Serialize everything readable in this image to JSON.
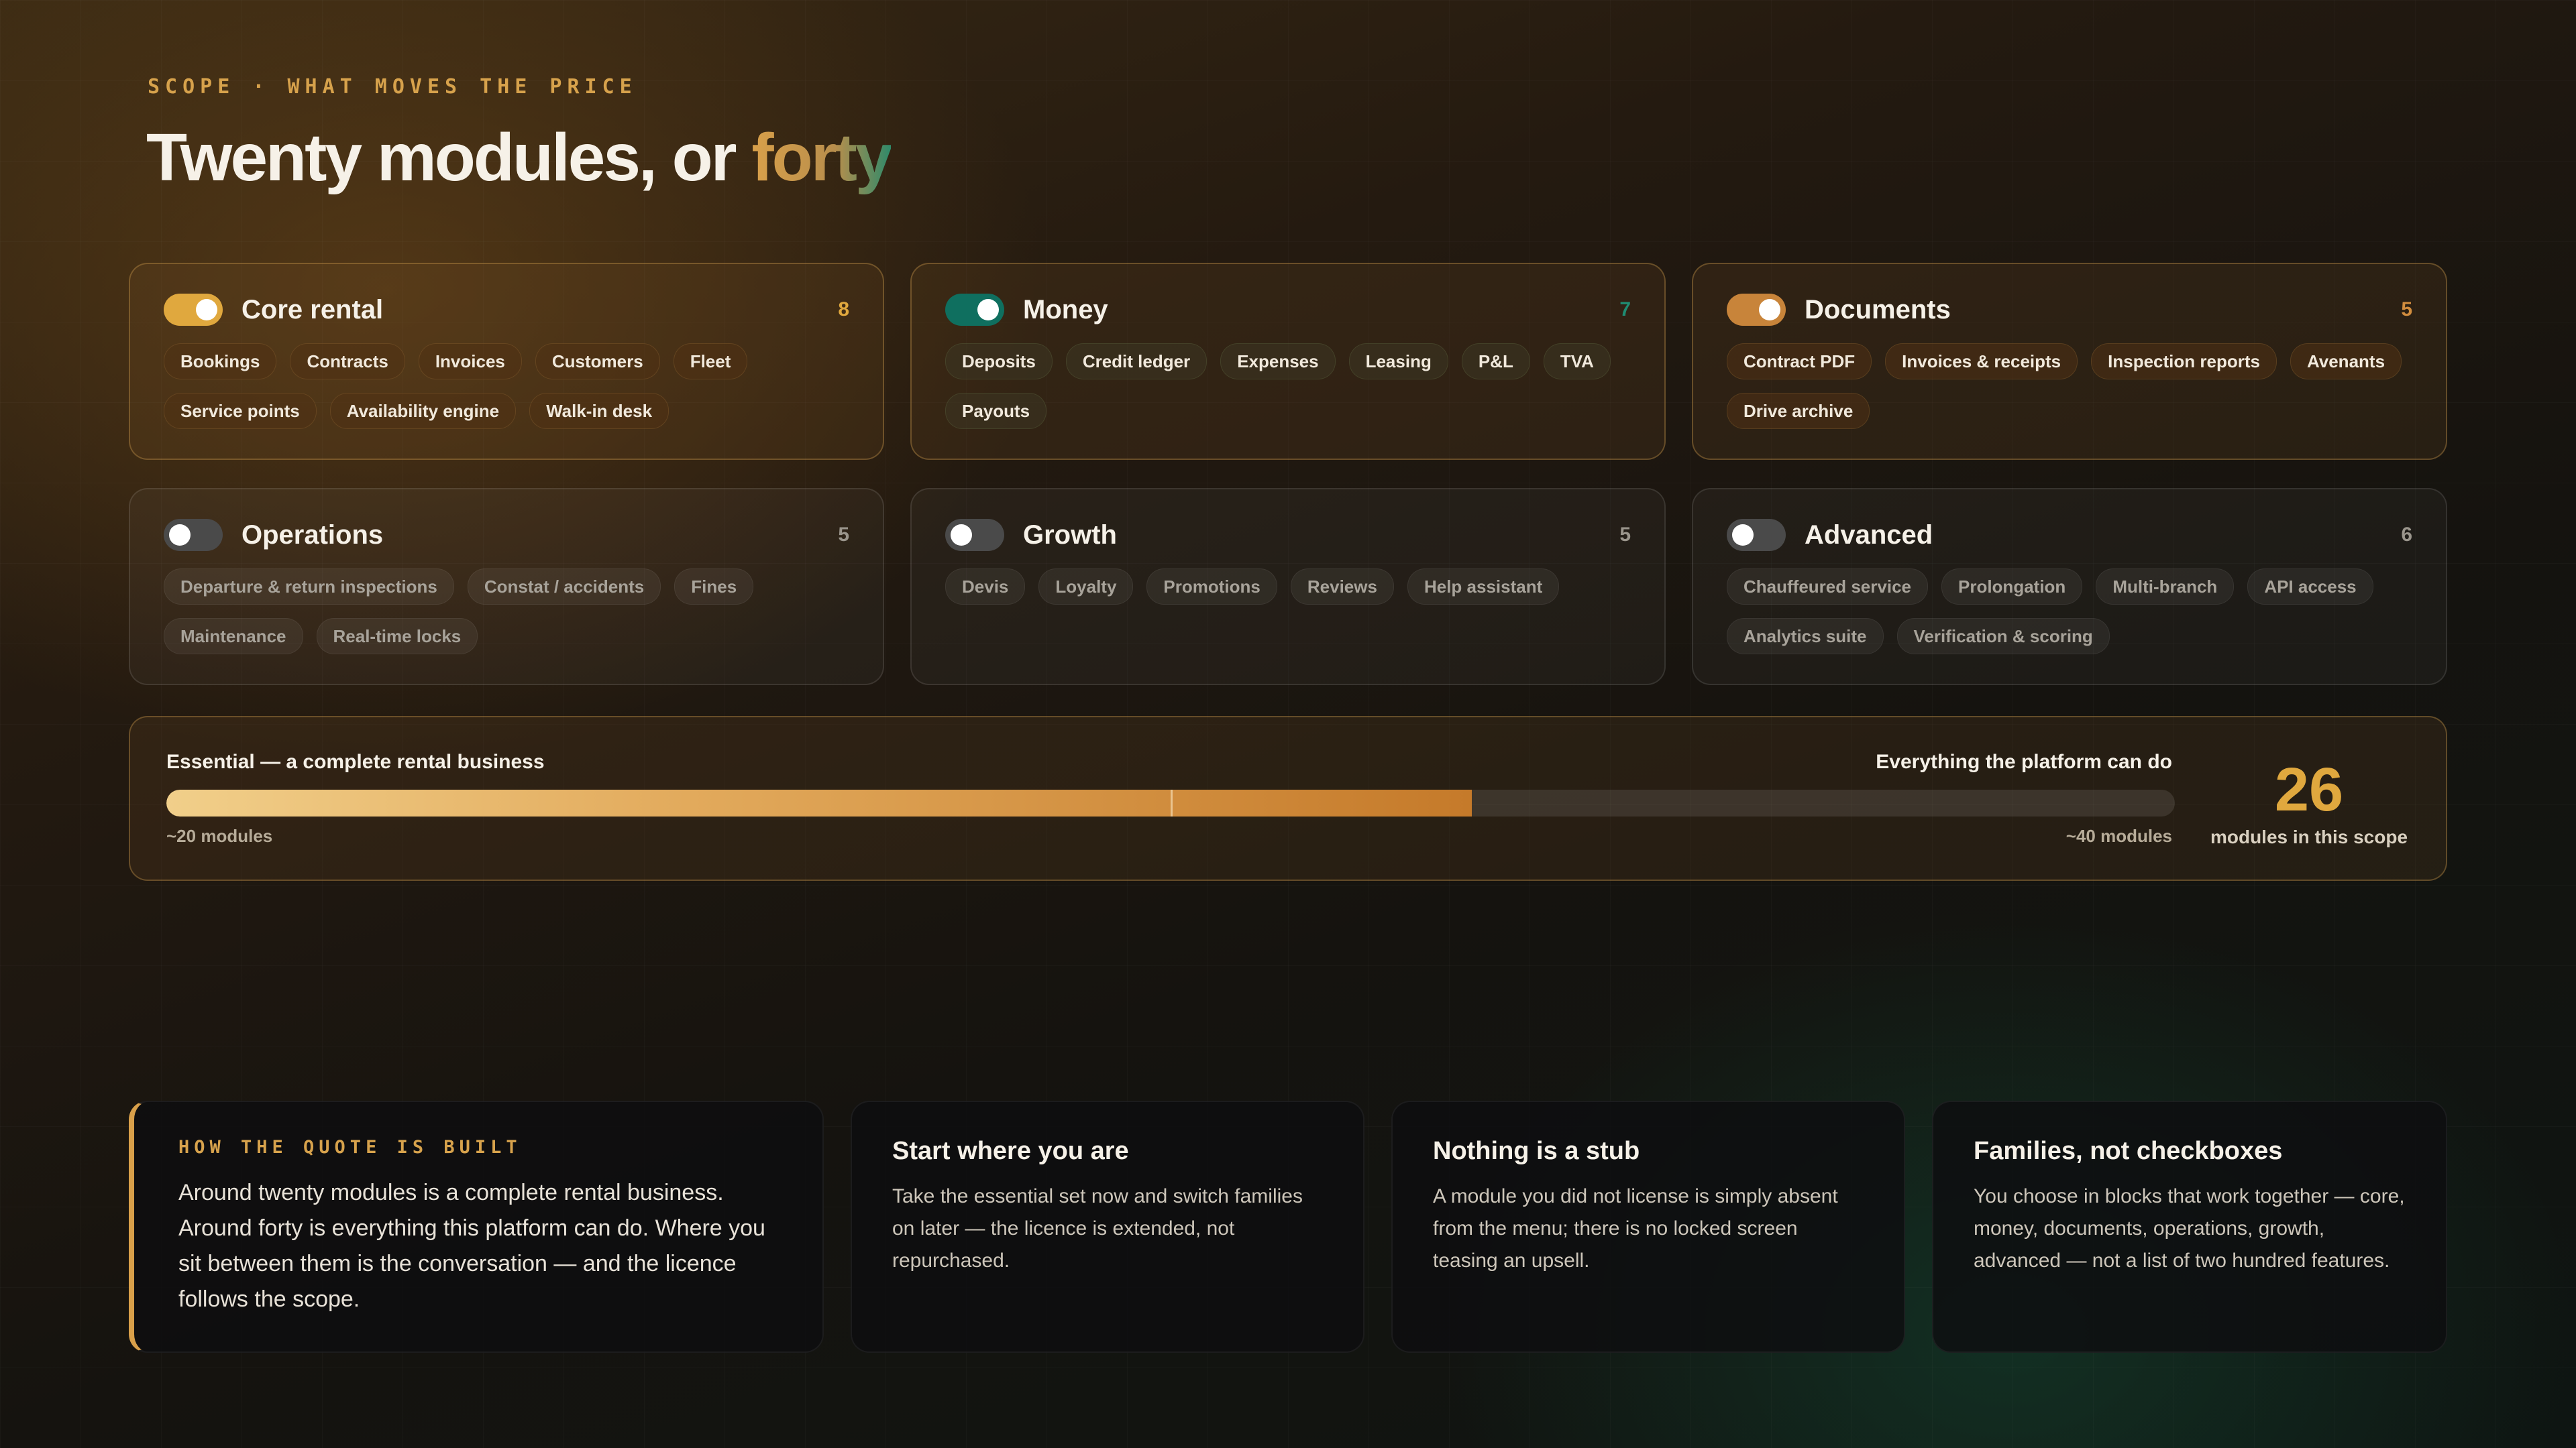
{
  "header": {
    "eyebrow": "SCOPE · WHAT MOVES THE PRICE",
    "title_main": "Twenty modules, or ",
    "title_accent": "forty"
  },
  "families": [
    {
      "name": "Core rental",
      "count": "8",
      "enabled": true,
      "color": "#e0a83e",
      "modules": [
        "Bookings",
        "Contracts",
        "Invoices",
        "Customers",
        "Fleet",
        "Service points",
        "Availability engine",
        "Walk-in desk"
      ]
    },
    {
      "name": "Money",
      "count": "7",
      "enabled": true,
      "color": "#0f6f5f",
      "modules": [
        "Deposits",
        "Credit ledger",
        "Expenses",
        "Leasing",
        "P&L",
        "TVA",
        "Payouts"
      ]
    },
    {
      "name": "Documents",
      "count": "5",
      "enabled": true,
      "color": "#c8843a",
      "modules": [
        "Contract PDF",
        "Invoices & receipts",
        "Inspection reports",
        "Avenants",
        "Drive archive"
      ]
    },
    {
      "name": "Operations",
      "count": "5",
      "enabled": false,
      "modules": [
        "Departure & return inspections",
        "Constat / accidents",
        "Fines",
        "Maintenance",
        "Real-time locks"
      ]
    },
    {
      "name": "Growth",
      "count": "5",
      "enabled": false,
      "modules": [
        "Devis",
        "Loyalty",
        "Promotions",
        "Reviews",
        "Help assistant"
      ]
    },
    {
      "name": "Advanced",
      "count": "6",
      "enabled": false,
      "modules": [
        "Chauffeured service",
        "Prolongation",
        "Multi-branch",
        "API access",
        "Analytics suite",
        "Verification & scoring"
      ]
    }
  ],
  "scope": {
    "left_label": "Essential — a complete rental business",
    "right_label": "Everything the platform can do",
    "min_label": "~20 modules",
    "max_label": "~40 modules",
    "count": "26",
    "count_label": "modules in this scope",
    "fill_fraction": 0.65,
    "marker_fraction": 0.5
  },
  "info": {
    "primary": {
      "eyebrow": "HOW THE QUOTE IS BUILT",
      "text": "Around twenty modules is a complete rental business. Around forty is everything this platform can do. Where you sit between them is the conversation — and the licence follows the scope."
    },
    "cards": [
      {
        "title": "Start where you are",
        "text": "Take the essential set now and switch families on later — the licence is extended, not repurchased."
      },
      {
        "title": "Nothing is a stub",
        "text": "A module you did not license is simply absent from the menu; there is no locked screen teasing an upsell."
      },
      {
        "title": "Families, not checkboxes",
        "text": "You choose in blocks that work together — core, money, documents, operations, growth, advanced — not a list of two hundred features."
      }
    ]
  }
}
